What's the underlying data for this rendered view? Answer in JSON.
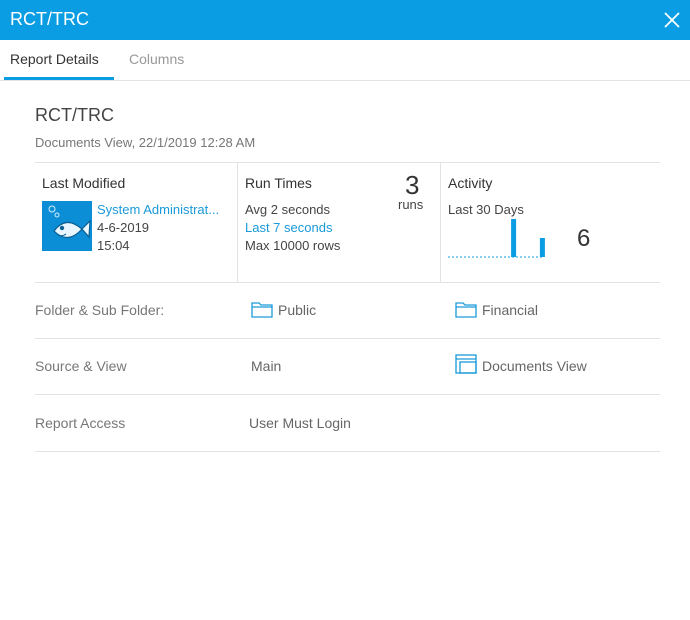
{
  "window": {
    "title": "RCT/TRC"
  },
  "tabs": [
    {
      "label": "Report Details",
      "active": true
    },
    {
      "label": "Columns",
      "active": false
    }
  ],
  "report": {
    "name": "RCT/TRC",
    "subtitle": "Documents View, 22/1/2019 12:28 AM"
  },
  "last_modified": {
    "heading": "Last Modified",
    "user": "System Administrat...",
    "date": "4-6-2019",
    "time": "15:04"
  },
  "run_times": {
    "heading": "Run Times",
    "avg": "Avg  2 seconds",
    "last": "Last 7 seconds",
    "max": "Max 10000 rows",
    "count": "3",
    "count_label": "runs"
  },
  "activity": {
    "heading": "Activity",
    "period": "Last 30 Days",
    "total": "6",
    "bar_values": [
      0,
      0,
      0,
      0,
      0,
      0,
      0,
      0,
      0,
      0,
      0,
      0,
      0,
      0,
      0,
      0,
      0,
      0,
      0,
      0,
      4,
      0,
      0,
      0,
      0,
      0,
      0,
      0,
      0,
      2
    ],
    "bar_color": "#0b9de3"
  },
  "details": {
    "folder": {
      "label": "Folder & Sub Folder:",
      "folder": "Public",
      "sub_folder": "Financial"
    },
    "source": {
      "label": "Source & View",
      "source": "Main",
      "view": "Documents View"
    },
    "access": {
      "label": "Report Access",
      "value": "User Must Login"
    }
  },
  "colors": {
    "accent": "#0b9de3",
    "link": "#1a9ad9"
  },
  "icons": [
    "close-icon",
    "user-avatar-fish-icon",
    "folder-icon",
    "view-icon"
  ]
}
